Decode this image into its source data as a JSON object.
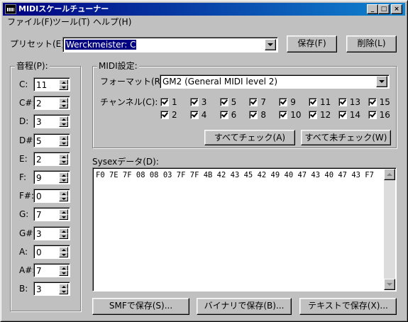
{
  "window": {
    "title": "MIDIスケールチューナー",
    "icon": "midi-keyboard-icon"
  },
  "title_buttons": {
    "minimize": "_",
    "maximize": "□",
    "close": "×"
  },
  "menu": [
    "ファイル(F)",
    "ツール(T)",
    "ヘルプ(H)"
  ],
  "preset": {
    "label": "プリセット(E):",
    "value": "Werckmeister: C",
    "save_label": "保存(F)",
    "delete_label": "削除(L)"
  },
  "pitch_group": {
    "title": "音程(P):",
    "notes": [
      {
        "name": "C:",
        "value": "11"
      },
      {
        "name": "C#:",
        "value": "2"
      },
      {
        "name": "D:",
        "value": "3"
      },
      {
        "name": "D#:",
        "value": "5"
      },
      {
        "name": "E:",
        "value": "2"
      },
      {
        "name": "F:",
        "value": "9"
      },
      {
        "name": "F#:",
        "value": "0"
      },
      {
        "name": "G:",
        "value": "7"
      },
      {
        "name": "G#:",
        "value": "3"
      },
      {
        "name": "A:",
        "value": "0"
      },
      {
        "name": "A#:",
        "value": "7"
      },
      {
        "name": "B:",
        "value": "3"
      }
    ]
  },
  "midi_group": {
    "title": "MIDI設定:",
    "format_label": "フォーマット(R):",
    "format_value": "GM2 (General MIDI level 2)",
    "channel_label": "チャンネル(C):",
    "channels": [
      "1",
      "3",
      "5",
      "7",
      "9",
      "11",
      "13",
      "15",
      "2",
      "4",
      "6",
      "8",
      "10",
      "12",
      "14",
      "16"
    ],
    "check_all_label": "すべてチェック(A)",
    "uncheck_all_label": "すべて未チェック(W)"
  },
  "sysex": {
    "label": "Sysexデータ(D):",
    "data": "F0 7E 7F 08 08 03 7F 7F 4B 42 43 45 42 49 40 47 43 40 47 43 F7"
  },
  "bottom_buttons": {
    "smf_label": "SMFで保存(S)...",
    "binary_label": "バイナリで保存(B)...",
    "text_label": "テキストで保存(X)..."
  },
  "colors": {
    "face": "#c0c0c0",
    "title_start": "#000080",
    "title_end": "#1084d0",
    "selection": "#000080"
  }
}
